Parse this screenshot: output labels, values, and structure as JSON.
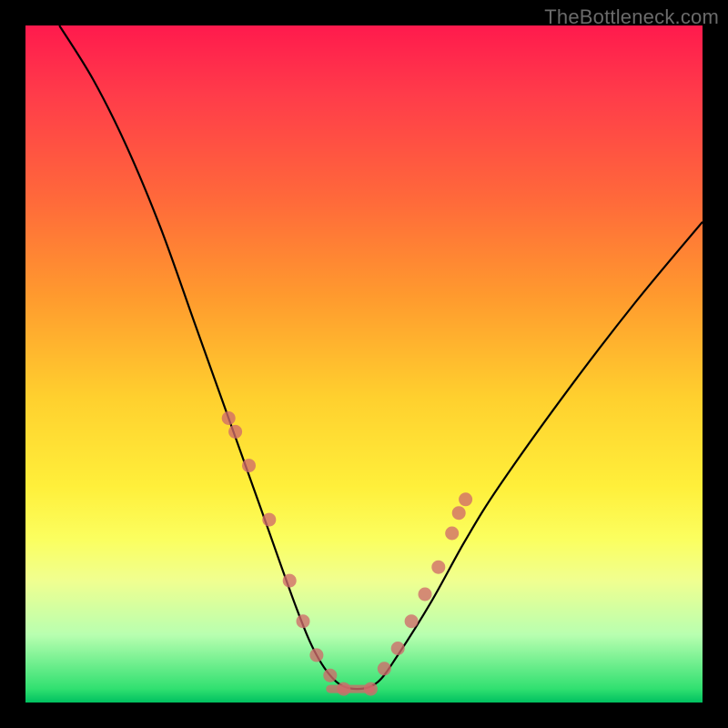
{
  "watermark": "TheBottleneck.com",
  "colors": {
    "gradient_top": "#ff1a4d",
    "gradient_bottom": "#00c060",
    "curve": "#000000",
    "marker": "#d06a6a"
  },
  "chart_data": {
    "type": "line",
    "title": "",
    "xlabel": "",
    "ylabel": "",
    "xlim": [
      0,
      100
    ],
    "ylim": [
      0,
      100
    ],
    "series": [
      {
        "name": "bottleneck-curve",
        "x": [
          5,
          10,
          15,
          20,
          25,
          30,
          35,
          40,
          43,
          46,
          49,
          52,
          55,
          60,
          65,
          70,
          80,
          90,
          100
        ],
        "y": [
          100,
          92,
          82,
          70,
          56,
          42,
          28,
          14,
          7,
          3,
          2,
          3,
          7,
          15,
          24,
          32,
          46,
          59,
          71
        ]
      }
    ],
    "markers": {
      "name": "highlight-points",
      "x": [
        30,
        31,
        33,
        36,
        39,
        41,
        43,
        45,
        47,
        51,
        53,
        55,
        57,
        59,
        61,
        63,
        64,
        65
      ],
      "y": [
        42,
        40,
        35,
        27,
        18,
        12,
        7,
        4,
        2,
        2,
        5,
        8,
        12,
        16,
        20,
        25,
        28,
        30
      ]
    },
    "flat_segment": {
      "x0": 45,
      "x1": 51,
      "y": 2
    },
    "annotations": []
  }
}
